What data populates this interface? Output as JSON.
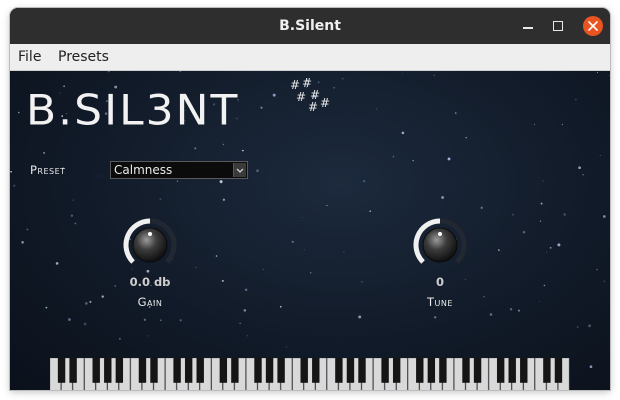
{
  "window": {
    "title": "B.Silent",
    "controls": [
      "minimize-icon",
      "maximize-icon",
      "close-icon"
    ],
    "close_color": "#e95420"
  },
  "menubar": {
    "items": [
      {
        "label": "File"
      },
      {
        "label": "Presets"
      }
    ]
  },
  "plugin": {
    "logo_text": "B.SIL3NT",
    "preset": {
      "label": "Preset",
      "selected": "Calmness"
    },
    "knobs": [
      {
        "label": "Gain",
        "value_text": "0.0 db",
        "level": 0.5
      },
      {
        "label": "Tune",
        "value_text": "0",
        "level": 0.5
      }
    ],
    "keyboard": {
      "white_keys": 45
    }
  },
  "colors": {
    "background": "#111a28",
    "text": "#e8e8e8",
    "knob_arc": "#f0f0f0"
  }
}
